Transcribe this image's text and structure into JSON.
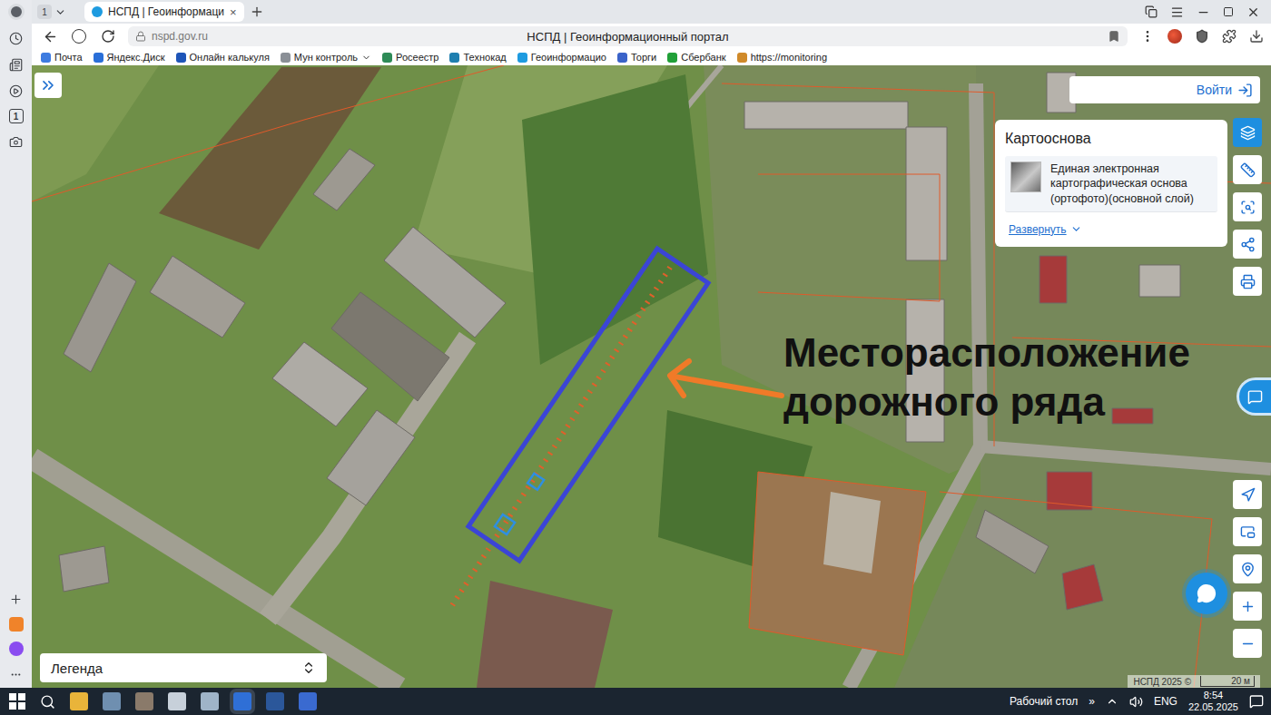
{
  "browser": {
    "sidebar_badge": "1",
    "tab_counter": "1",
    "tab": {
      "title": "НСПД | Геоинформаци",
      "close": "×",
      "selected": true
    },
    "address": "nspd.gov.ru",
    "page_title": "НСПД | Геоинформационный портал",
    "bookmarks": [
      {
        "label": "Почта",
        "color": "#3d7be0"
      },
      {
        "label": "Яндекс.Диск",
        "color": "#2a6fd8"
      },
      {
        "label": "Онлайн калькуля",
        "color": "#1e55b8"
      },
      {
        "label": "Мун контроль",
        "color": "#8a8f96"
      },
      {
        "label": "Росеестр",
        "color": "#2e8b57"
      },
      {
        "label": "Технокад",
        "color": "#1f7fb0"
      },
      {
        "label": "Геоинформацио",
        "color": "#1e9be0"
      },
      {
        "label": "Торги",
        "color": "#3a63c9"
      },
      {
        "label": "Сбербанк",
        "color": "#21a038"
      },
      {
        "label": "https://monitoring",
        "color": "#d08a2a"
      }
    ]
  },
  "map": {
    "annotation": [
      "Месторасположение",
      "дорожного ряда"
    ],
    "login_button": "Войти",
    "basemap_panel": {
      "title": "Картооснова",
      "layer": "Единая электронная картографическая основа (ортофото)(основной слой)",
      "expand": "Развернуть"
    },
    "toolbar_top": [
      {
        "kind": "layers",
        "selected": true
      },
      {
        "kind": "ruler",
        "selected": false
      },
      {
        "kind": "select",
        "selected": false
      },
      {
        "kind": "share",
        "selected": false
      },
      {
        "kind": "print",
        "selected": false
      }
    ],
    "toolbar_bottom": [
      {
        "kind": "locate",
        "selected": false
      },
      {
        "kind": "minimap",
        "selected": false
      },
      {
        "kind": "pin",
        "selected": false
      },
      {
        "kind": "zoom-in",
        "selected": false
      },
      {
        "kind": "zoom-out",
        "selected": false
      }
    ],
    "legend": {
      "label": "Легенда"
    },
    "attribution": "НСПД 2025 ©",
    "scale": "20 м"
  },
  "taskbar": {
    "desktop": "Рабочий стол",
    "overflow": "»",
    "language": "ENG",
    "time": "8:54",
    "date": "22.05.2025"
  }
}
